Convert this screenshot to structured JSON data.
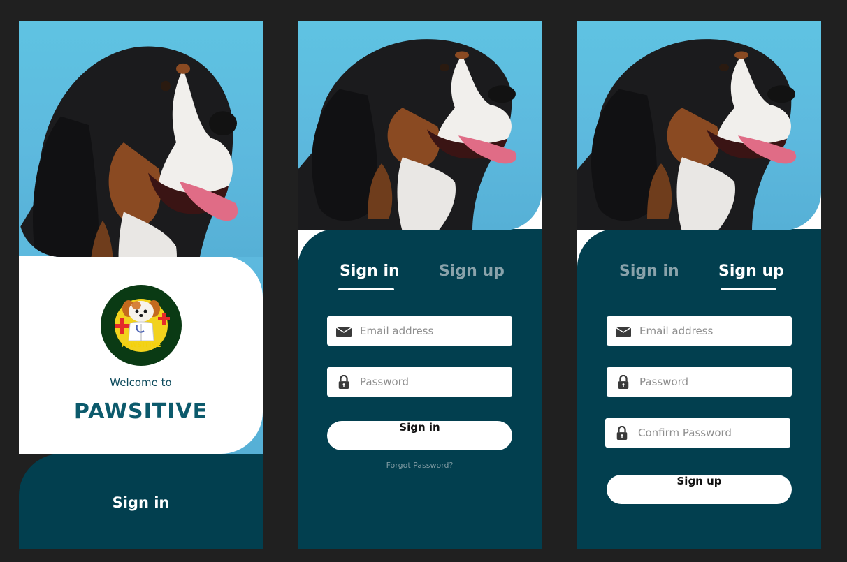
{
  "colors": {
    "background": "#202020",
    "dark_teal": "#023f4f",
    "brand_teal": "#0c5a6c",
    "sky": "#5fc3e2"
  },
  "welcome_screen": {
    "logo_text": "PAWSITIVE",
    "welcome_text": "Welcome to",
    "brand_name": "PAWSITIVE",
    "signin_label": "Sign in"
  },
  "signin_screen": {
    "tab_signin": "Sign in",
    "tab_signup": "Sign up",
    "email_placeholder": "Email address",
    "password_placeholder": "Password",
    "button_label": "Sign in",
    "forgot_label": "Forgot Password?"
  },
  "signup_screen": {
    "tab_signin": "Sign in",
    "tab_signup": "Sign up",
    "email_placeholder": "Email address",
    "password_placeholder": "Password",
    "confirm_placeholder": "Confirm Password",
    "button_label": "Sign up"
  },
  "icons": {
    "email": "envelope-icon",
    "password": "lock-icon"
  }
}
